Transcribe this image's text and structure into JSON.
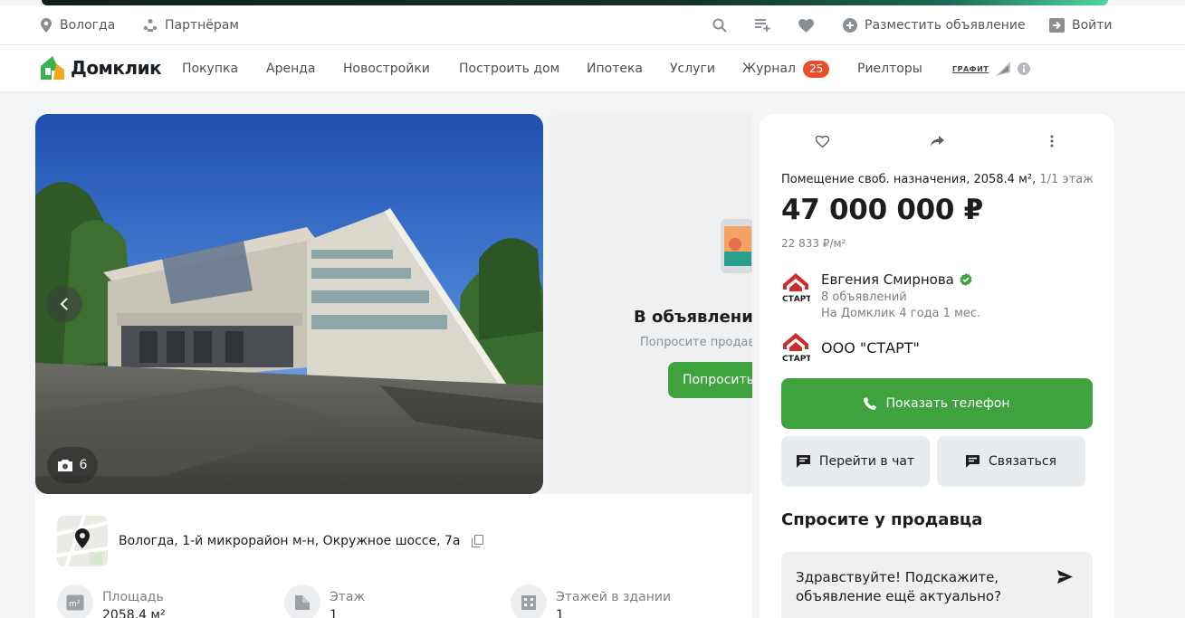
{
  "topbar": {
    "city": "Вологда",
    "partners": "Партнёрам",
    "post_ad": "Разместить объявление",
    "login": "Войти"
  },
  "nav": {
    "logo": "Домклик",
    "items": [
      "Покупка",
      "Аренда",
      "Новостройки",
      "Построить дом",
      "Ипотека",
      "Услуги",
      "Журнал",
      "Риелторы"
    ],
    "journal_badge": "25",
    "partner_logo": "ГРАФИТ"
  },
  "gallery": {
    "photo_count": "6",
    "side_title": "В объявлении",
    "side_subtitle": "Попросите продав",
    "side_button": "Попросить"
  },
  "info": {
    "address": "Вологда, 1-й микрорайон м-н, Окружное шоссе, 7а",
    "specs": [
      {
        "label": "Площадь",
        "value": "2058,4 м²"
      },
      {
        "label": "Этаж",
        "value": "1"
      },
      {
        "label": "Этажей в здании",
        "value": "1"
      }
    ]
  },
  "offer": {
    "title": "Помещение своб. назначения, 2058.4 м²,",
    "floor": "1/1 этаж",
    "price": "47 000 000 ₽",
    "price_per_m2": "22 833 ₽/м²",
    "agent_name": "Евгения Смирнова",
    "agent_ads": "8 объявлений",
    "agent_since": "На Домклик 4 года 1 мес.",
    "agency_name": "ООО \"СТАРТ\"",
    "agency_logo_text": "СТАРТ",
    "show_phone": "Показать телефон",
    "chat": "Перейти в чат",
    "contact": "Связаться",
    "ask_title": "Спросите у продавца",
    "ask_message": "Здравствуйте! Подскажите, объявление ещё актуально?"
  },
  "colors": {
    "green": "#3ea33e",
    "badge": "#e84e2e",
    "agency_red": "#c9302c"
  }
}
